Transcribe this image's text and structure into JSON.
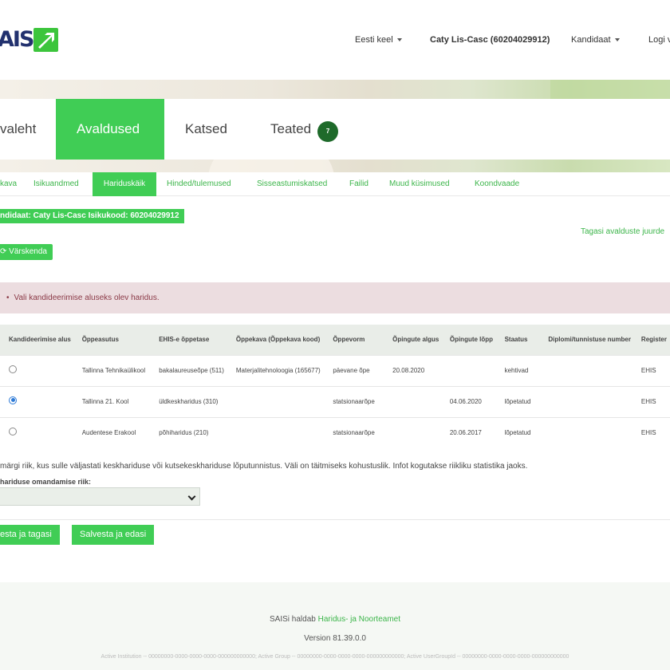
{
  "header": {
    "logo_text": "AIS",
    "language": "Eesti keel",
    "user": "Caty Lis-Casc (60204029912)",
    "role": "Kandidaat",
    "logout": "Logi v"
  },
  "main_tabs": [
    {
      "label": "valeht"
    },
    {
      "label": "Avaldused"
    },
    {
      "label": "Katsed"
    },
    {
      "label": "Teated",
      "badge": "7"
    }
  ],
  "sub_nav": [
    {
      "label": "kava"
    },
    {
      "label": "Isikuandmed"
    },
    {
      "label": "Hariduskäik"
    },
    {
      "label": "Hinded/tulemused"
    },
    {
      "label": "Sisseastumiskatsed"
    },
    {
      "label": "Failid"
    },
    {
      "label": "Muud küsimused"
    },
    {
      "label": "Koondvaade"
    }
  ],
  "candidate_label": "ndidaat: Caty Lis-Casc Isikukood: 60204029912",
  "back_link": "Tagasi avalduste juurde",
  "refresh_button": "Värskenda",
  "alert": "Vali kandideerimise aluseks olev haridus.",
  "table": {
    "headers": [
      "Kandideerimise alus",
      "Õppeasutus",
      "EHIS-e õppetase",
      "Õppekava (Õppekava kood)",
      "Õppevorm",
      "Õpingute algus",
      "Õpingute lõpp",
      "Staatus",
      "Diplomi/tunnistuse number",
      "Register"
    ],
    "rows": [
      {
        "selected": false,
        "institution": "Tallinna Tehnikaülikool",
        "level": "bakalaureuseõpe (511)",
        "curriculum": "Materjalitehnoloogia (165677)",
        "form": "päevane õpe",
        "start": "20.08.2020",
        "end": "",
        "status": "kehtivad",
        "diploma": "",
        "register": "EHIS"
      },
      {
        "selected": true,
        "institution": "Tallinna 21. Kool",
        "level": "üldkeskharidus (310)",
        "curriculum": "",
        "form": "statsionaarõpe",
        "start": "",
        "end": "04.06.2020",
        "status": "lõpetatud",
        "diploma": "",
        "register": "EHIS"
      },
      {
        "selected": false,
        "institution": "Audentese Erakool",
        "level": "põhiharidus (210)",
        "curriculum": "",
        "form": "statsionaarõpe",
        "start": "",
        "end": "20.06.2017",
        "status": "lõpetatud",
        "diploma": "",
        "register": "EHIS"
      }
    ]
  },
  "info_text": "märgi riik, kus sulle väljastati keskhariduse või kutsekeskhariduse lõputunnistus. Väli on täitmiseks kohustuslik. Infot kogutakse riikliku statistika jaoks.",
  "country_field": {
    "label": "hariduse omandamise riik:",
    "value": ""
  },
  "buttons": {
    "save_back": "esta ja tagasi",
    "save_next": "Salvesta ja edasi"
  },
  "footer": {
    "maintained_prefix": "SAISi haldab ",
    "maintained_link": "Haridus- ja Noorteamet",
    "version": "Version 81.39.0.0",
    "ids": "Active Institution -- 00000000-0000-0000-0000-000000000000; Active Group -- 00000000-0000-0000-0000-000000000000; Active UserGroupId -- 00000000-0000-0000-0000-000000000000"
  },
  "colors": {
    "accent": "#40cd55",
    "brand": "#22316e",
    "badge": "#1e6a2a",
    "alert_bg": "#ecdde0"
  }
}
